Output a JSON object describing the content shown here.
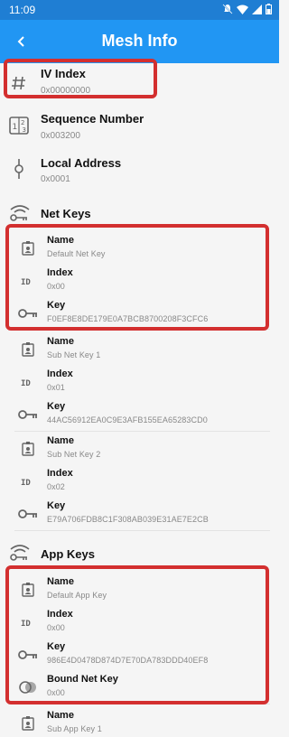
{
  "status_bar": {
    "time": "11:09"
  },
  "app_bar": {
    "title": "Mesh Info"
  },
  "iv_index": {
    "label": "IV Index",
    "value": "0x00000000"
  },
  "sequence_number": {
    "label": "Sequence Number",
    "value": "0x003200"
  },
  "local_address": {
    "label": "Local Address",
    "value": "0x0001"
  },
  "net_keys": {
    "title": "Net Keys",
    "items": [
      {
        "name_label": "Name",
        "name": "Default Net Key",
        "index_label": "Index",
        "index": "0x00",
        "key_label": "Key",
        "key": "F0EF8E8DE179E0A7BCB8700208F3CFC6"
      },
      {
        "name_label": "Name",
        "name": "Sub Net Key 1",
        "index_label": "Index",
        "index": "0x01",
        "key_label": "Key",
        "key": "44AC56912EA0C9E3AFB155EA65283CD0"
      },
      {
        "name_label": "Name",
        "name": "Sub Net Key 2",
        "index_label": "Index",
        "index": "0x02",
        "key_label": "Key",
        "key": "E79A706FDB8C1F308AB039E31AE7E2CB"
      }
    ]
  },
  "app_keys": {
    "title": "App Keys",
    "items": [
      {
        "name_label": "Name",
        "name": "Default App Key",
        "index_label": "Index",
        "index": "0x00",
        "key_label": "Key",
        "key": "986E4D0478D874D7E70DA783DDD40EF8",
        "bound_label": "Bound Net Key",
        "bound": "0x00"
      },
      {
        "name_label": "Name",
        "name": "Sub App Key 1"
      }
    ]
  },
  "icons": {
    "back": "arrow-left-icon",
    "iv": "hash-icon",
    "seq": "numbers-icon",
    "addr": "location-pin-icon",
    "keys": "wifi-key-icon",
    "name": "badge-icon",
    "index": "id-icon",
    "key": "key-icon",
    "bound": "link-circles-icon"
  },
  "colors": {
    "status_bar": "#1f7ed3",
    "app_bar": "#2196f3",
    "highlight": "#d32f2f"
  }
}
